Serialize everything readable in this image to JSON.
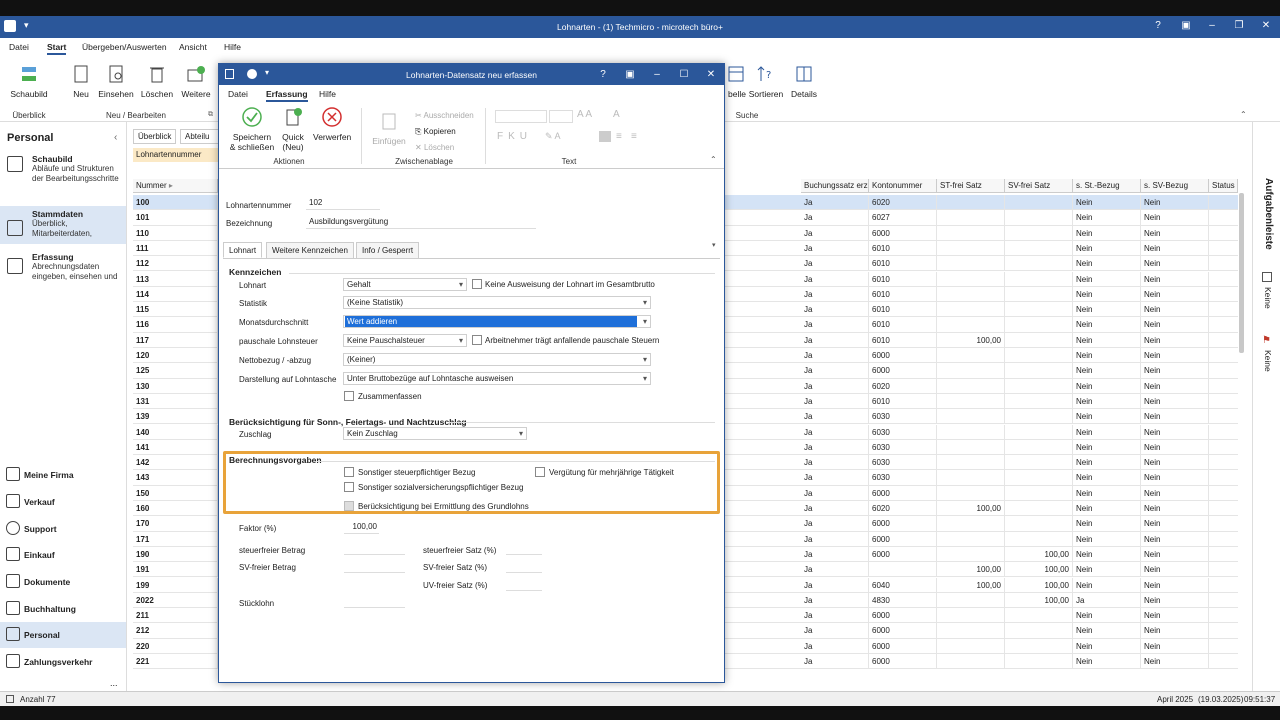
{
  "app": {
    "title": "Lohnarten - (1) Techmicro - microtech büro+",
    "help": "?",
    "menu": [
      "Datei",
      "Start",
      "Übergeben/Auswerten",
      "Ansicht",
      "Hilfe"
    ]
  },
  "ribbon": {
    "schaubild": "Schaubild",
    "neu": "Neu",
    "einsehen": "Einsehen",
    "loeschen": "Löschen",
    "weitere": "Weitere",
    "belle": "belle",
    "sortieren": "Sortieren",
    "details": "Details",
    "group_ueberblick": "Überblick",
    "group_neu": "Neu / Bearbeiten",
    "group_suche": "Suche"
  },
  "sidebar": {
    "title": "Personal",
    "items": [
      {
        "title": "Schaubild",
        "desc": "Abläufe und Strukturen der Bearbeitungsschritte"
      },
      {
        "title": "Stammdaten",
        "desc": "Überblick, Mitarbeiterdaten,"
      },
      {
        "title": "Erfassung",
        "desc": "Abrechnungsdaten eingeben, einsehen und"
      }
    ],
    "nav": [
      "Meine Firma",
      "Verkauf",
      "Support",
      "Einkauf",
      "Dokumente",
      "Buchhaltung",
      "Personal",
      "Zahlungsverkehr"
    ],
    "more": "..."
  },
  "tabs": {
    "ueberblick": "Überblick",
    "abteilung": "Abteilu",
    "filter": "Lohnartennummer"
  },
  "grid": {
    "headers": [
      "Nummer",
      "Buchungssatz erze",
      "Kontonummer",
      "ST-frei Satz",
      "SV-frei Satz",
      "s. St.-Bezug",
      "s. SV-Bezug",
      "Status"
    ],
    "rows": [
      [
        "100",
        "Ja",
        "6020",
        "",
        "",
        "Nein",
        "Nein"
      ],
      [
        "101",
        "Ja",
        "6027",
        "",
        "",
        "Nein",
        "Nein"
      ],
      [
        "110",
        "Ja",
        "6000",
        "",
        "",
        "Nein",
        "Nein"
      ],
      [
        "111",
        "Ja",
        "6010",
        "",
        "",
        "Nein",
        "Nein"
      ],
      [
        "112",
        "Ja",
        "6010",
        "",
        "",
        "Nein",
        "Nein"
      ],
      [
        "113",
        "Ja",
        "6010",
        "",
        "",
        "Nein",
        "Nein"
      ],
      [
        "114",
        "Ja",
        "6010",
        "",
        "",
        "Nein",
        "Nein"
      ],
      [
        "115",
        "Ja",
        "6010",
        "",
        "",
        "Nein",
        "Nein"
      ],
      [
        "116",
        "Ja",
        "6010",
        "",
        "",
        "Nein",
        "Nein"
      ],
      [
        "117",
        "Ja",
        "6010",
        "100,00",
        "",
        "Nein",
        "Nein"
      ],
      [
        "120",
        "Ja",
        "6000",
        "",
        "",
        "Nein",
        "Nein"
      ],
      [
        "125",
        "Ja",
        "6000",
        "",
        "",
        "Nein",
        "Nein"
      ],
      [
        "130",
        "Ja",
        "6020",
        "",
        "",
        "Nein",
        "Nein"
      ],
      [
        "131",
        "Ja",
        "6010",
        "",
        "",
        "Nein",
        "Nein"
      ],
      [
        "139",
        "Ja",
        "6030",
        "",
        "",
        "Nein",
        "Nein"
      ],
      [
        "140",
        "Ja",
        "6030",
        "",
        "",
        "Nein",
        "Nein"
      ],
      [
        "141",
        "Ja",
        "6030",
        "",
        "",
        "Nein",
        "Nein"
      ],
      [
        "142",
        "Ja",
        "6030",
        "",
        "",
        "Nein",
        "Nein"
      ],
      [
        "143",
        "Ja",
        "6030",
        "",
        "",
        "Nein",
        "Nein"
      ],
      [
        "150",
        "Ja",
        "6000",
        "",
        "",
        "Nein",
        "Nein"
      ],
      [
        "160",
        "Ja",
        "6020",
        "100,00",
        "",
        "Nein",
        "Nein"
      ],
      [
        "170",
        "Ja",
        "6000",
        "",
        "",
        "Nein",
        "Nein"
      ],
      [
        "171",
        "Ja",
        "6000",
        "",
        "",
        "Nein",
        "Nein"
      ],
      [
        "190",
        "Ja",
        "6000",
        "",
        "100,00",
        "Nein",
        "Nein"
      ],
      [
        "191",
        "Ja",
        "",
        "100,00",
        "100,00",
        "Nein",
        "Nein"
      ],
      [
        "199",
        "Ja",
        "6040",
        "100,00",
        "100,00",
        "Nein",
        "Nein"
      ],
      [
        "2022",
        "Ja",
        "4830",
        "",
        "100,00",
        "Ja",
        "Nein"
      ],
      [
        "211",
        "Ja",
        "6000",
        "",
        "",
        "Nein",
        "Nein"
      ],
      [
        "212",
        "Ja",
        "6000",
        "",
        "",
        "Nein",
        "Nein"
      ],
      [
        "220",
        "Ja",
        "6000",
        "",
        "",
        "Nein",
        "Nein"
      ],
      [
        "221",
        "Ja",
        "6000",
        "",
        "",
        "Nein",
        "Nein"
      ]
    ]
  },
  "statusbar": {
    "count": "Anzahl 77",
    "period": "April 2025",
    "date": "(19.03.2025)",
    "time": "09:51:37"
  },
  "rightbar": {
    "aufgaben": "Aufgabenleiste",
    "keine1": "Keine",
    "keine2": "Keine"
  },
  "dialog": {
    "title": "Lohnarten-Datensatz neu erfassen",
    "help": "?",
    "menu": [
      "Datei",
      "Erfassung",
      "Hilfe"
    ],
    "ribbon": {
      "speichern": "Speichern & schließen",
      "quick": "Quick (Neu)",
      "verwerfen": "Verwerfen",
      "group_aktionen": "Aktionen",
      "einfuegen": "Einfügen",
      "ausschneiden": "Ausschneiden",
      "kopieren": "Kopieren",
      "loeschen": "Löschen",
      "group_zwischen": "Zwischenablage",
      "group_text": "Text"
    },
    "nummer_label": "Lohnartennummer",
    "nummer_value": "102",
    "bezeichnung_label": "Bezeichnung",
    "bezeichnung_value": "Ausbildungsvergütung",
    "tabs": [
      "Lohnart",
      "Weitere Kennzeichen",
      "Info / Gesperrt"
    ],
    "kennzeichen": {
      "title": "Kennzeichen",
      "lohnart_label": "Lohnart",
      "lohnart_value": "Gehalt",
      "keine_ausweisung": "Keine Ausweisung der Lohnart im Gesamtbrutto",
      "statistik_label": "Statistik",
      "statistik_value": "(Keine Statistik)",
      "monats_label": "Monatsdurchschnitt",
      "monats_value": "Wert addieren",
      "pauschal_label": "pauschale Lohnsteuer",
      "pauschal_value": "Keine Pauschalsteuer",
      "arbeitnehmer": "Arbeitnehmer trägt anfallende pauschale Steuern",
      "netto_label": "Nettobezug / -abzug",
      "netto_value": "(Keiner)",
      "darst_label": "Darstellung auf Lohntasche",
      "darst_value": "Unter Bruttobezüge auf Lohntasche ausweisen",
      "zusammen": "Zusammenfassen"
    },
    "zuschlag": {
      "title": "Berücksichtigung für Sonn-, Feiertags- und Nachtzuschlag",
      "label": "Zuschlag",
      "value": "Kein Zuschlag"
    },
    "berechnung": {
      "title": "Berechnungsvorgaben",
      "cb1": "Sonstiger steuerpflichtiger Bezug",
      "cb2": "Vergütung für mehrjährige Tätigkeit",
      "cb3": "Sonstiger sozialversicherungspflichtiger Bezug",
      "cb4": "Berücksichtigung bei Ermittlung des Grundlohns"
    },
    "faktor_label": "Faktor (%)",
    "faktor_value": "100,00",
    "st_betrag": "steuerfreier Betrag",
    "sv_betrag": "SV-freier Betrag",
    "st_satz": "steuerfreier Satz (%)",
    "sv_satz": "SV-freier Satz (%)",
    "uv_satz": "UV-freier Satz (%)",
    "stuecklohn": "Stücklohn"
  }
}
